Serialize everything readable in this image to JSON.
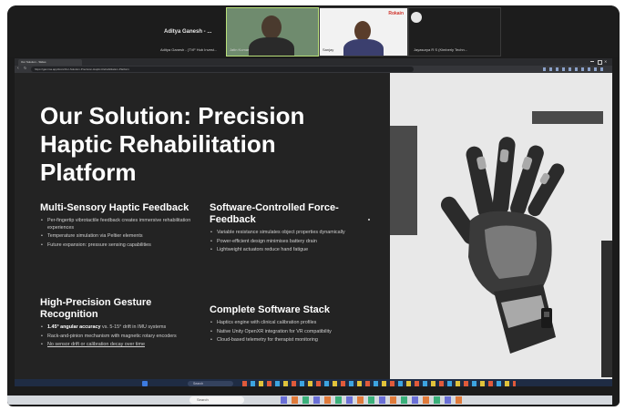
{
  "meeting": {
    "participant_name": "Aditya Ganesh - ...",
    "strip_labels": [
      "Aditya Ganesh - (TVF Hub Invest...",
      "Jayasurya R S (Kimberly Techn..."
    ],
    "tile1_label": "Jatin Kumar",
    "tile2_label": "Sanjay",
    "tile2_brand": "Rokain"
  },
  "browser": {
    "tab_label": "Our Solution - Slides",
    "url": "https://gamma.app/docs/Our-Solution-Precision-Haptic-Rehabilitation-Platform"
  },
  "slide": {
    "title": "Our Solution: Precision Haptic Rehabilitation Platform",
    "sections": [
      {
        "heading": "Multi-Sensory Haptic Feedback",
        "bullets": [
          "Per-fingertip vibrotactile feedback creates immersive rehabilitation experiences",
          "Temperature simulation via Peltier elements",
          "Future expansion: pressure sensing capabilities"
        ]
      },
      {
        "heading": "Software-Controlled Force-Feedback",
        "bullets": [
          "Variable resistance simulates object properties dynamically",
          "Power-efficient design minimises battery drain",
          "Lightweight actuators reduce hand fatigue"
        ]
      },
      {
        "heading": "High-Precision Gesture Recognition",
        "bullets_rich": [
          {
            "bold": "1.45° angular accuracy",
            "rest": " vs. 5-15° drift in IMU systems"
          },
          {
            "bold": "",
            "rest": "Rack-and-pinion mechanism with magnetic rotary encoders"
          },
          {
            "bold": "",
            "rest": "No sensor drift or calibration decay over time"
          }
        ]
      },
      {
        "heading": "Complete Software Stack",
        "bullets": [
          "Haptics engine with clinical calibration profiles",
          "Native Unity OpenXR integration for VR compatibility",
          "Cloud-based telemetry for therapist monitoring"
        ]
      }
    ]
  },
  "taskbar": {
    "search_label": "Search"
  },
  "colors": {
    "slide_bg": "#232323",
    "image_bg": "#e8e8e8",
    "glove_dark": "#2b2b2b",
    "glove_mid": "#7a7a7a",
    "glove_light": "#a9a9a9"
  }
}
